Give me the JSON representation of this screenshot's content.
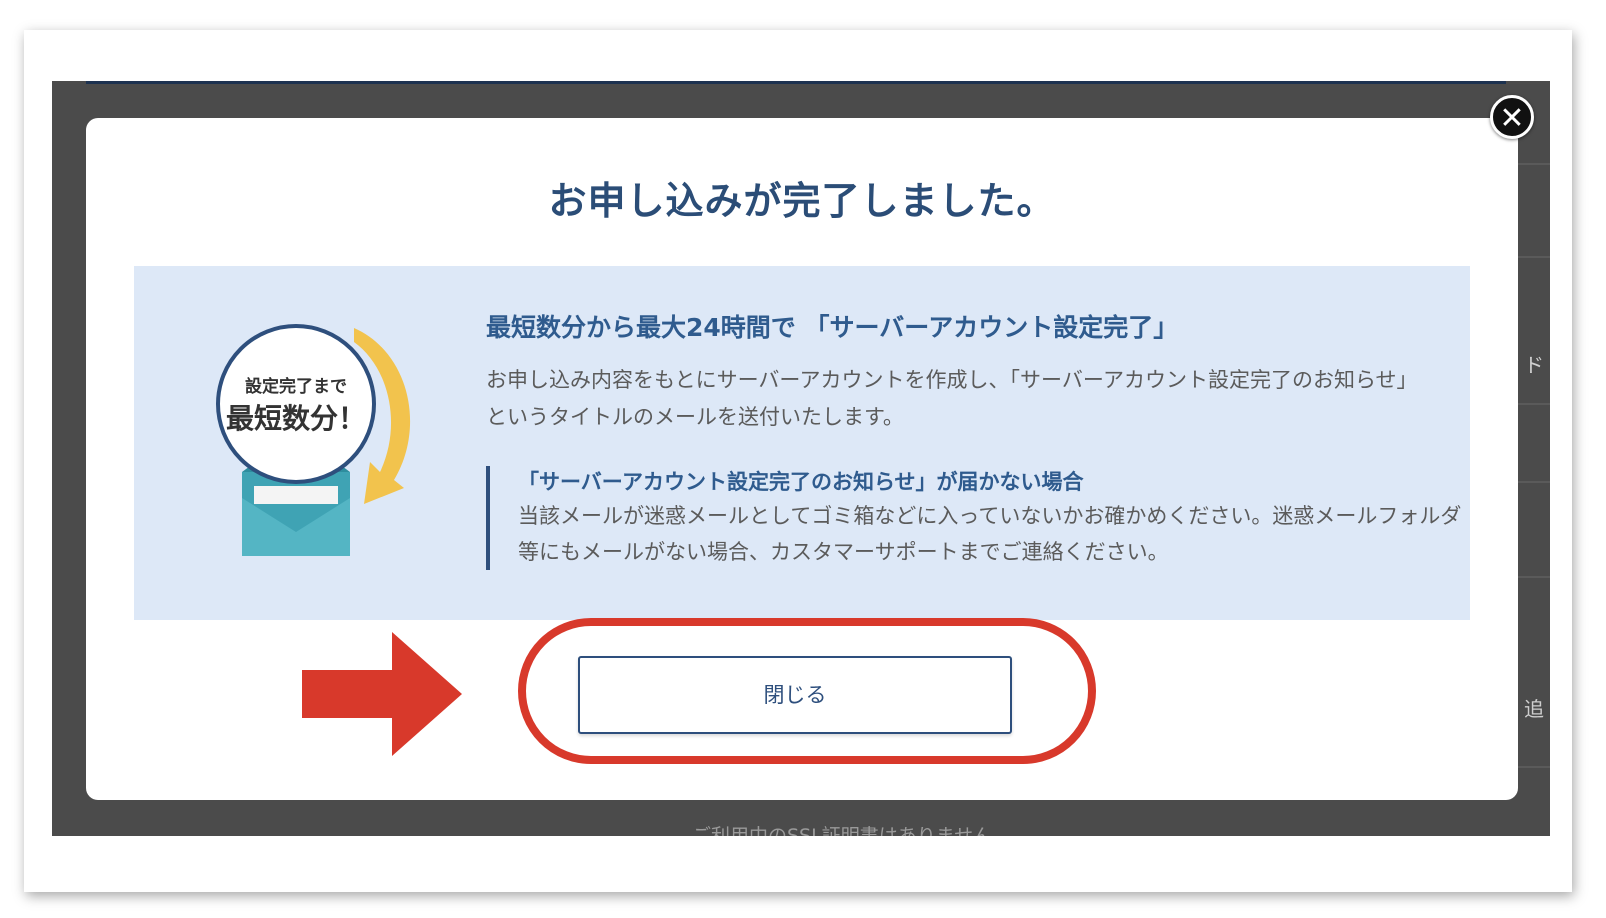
{
  "modal": {
    "title": "お申し込みが完了しました。",
    "close_icon": "close-icon",
    "badge": {
      "line1": "設定完了まで",
      "line2": "最短数分！"
    },
    "panel": {
      "heading": "最短数分から最大24時間で 「サーバーアカウント設定完了」",
      "body": "お申し込み内容をもとにサーバーアカウントを作成し、「サーバーアカウント設定完了のお知らせ」というタイトルのメールを送付いたします。",
      "note_title": "「サーバーアカウント設定完了のお知らせ」が届かない場合",
      "note_body": "当該メールが迷惑メールとしてゴミ箱などに入っていないかお確かめください。迷惑メールフォルダ等にもメールがない場合、カスタマーサポートまでご連絡ください。"
    },
    "close_button_label": "閉じる"
  },
  "background": {
    "right_text_1": "ド",
    "right_text_2": "追",
    "footer_text": "ご利用中のSSL証明書はありません"
  },
  "colors": {
    "accent": "#2e4f7d",
    "highlight": "#d8392b",
    "panel": "#dde8f7"
  }
}
